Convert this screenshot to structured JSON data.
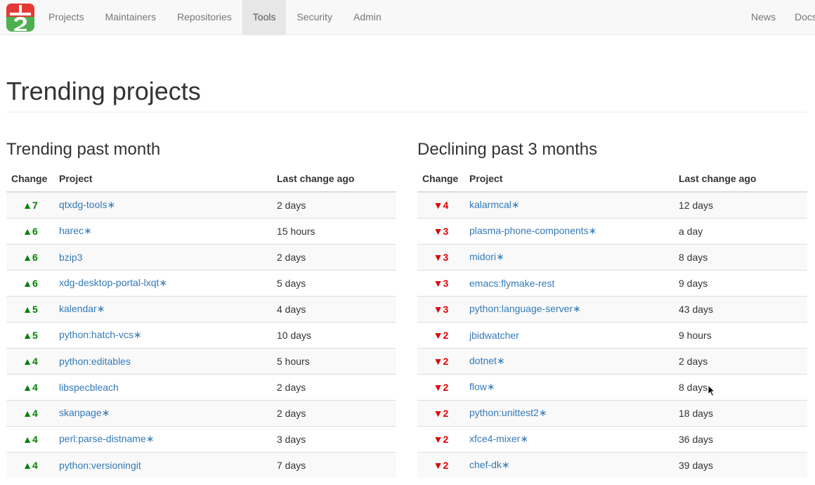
{
  "nav": {
    "left": [
      {
        "label": "Projects",
        "active": false
      },
      {
        "label": "Maintainers",
        "active": false
      },
      {
        "label": "Repositories",
        "active": false
      },
      {
        "label": "Tools",
        "active": true
      },
      {
        "label": "Security",
        "active": false
      },
      {
        "label": "Admin",
        "active": false
      }
    ],
    "right": [
      {
        "label": "News"
      },
      {
        "label": "Docs"
      }
    ]
  },
  "page_title": "Trending projects",
  "trending": {
    "title": "Trending past month",
    "columns": [
      "Change",
      "Project",
      "Last change ago"
    ],
    "rows": [
      {
        "change": "▲7",
        "project": "qtxdg-tools",
        "star": true,
        "ago": "2 days"
      },
      {
        "change": "▲6",
        "project": "harec",
        "star": true,
        "ago": "15 hours"
      },
      {
        "change": "▲6",
        "project": "bzip3",
        "star": false,
        "ago": "2 days"
      },
      {
        "change": "▲6",
        "project": "xdg-desktop-portal-lxqt",
        "star": true,
        "ago": "5 days"
      },
      {
        "change": "▲5",
        "project": "kalendar",
        "star": true,
        "ago": "4 days"
      },
      {
        "change": "▲5",
        "project": "python:hatch-vcs",
        "star": true,
        "ago": "10 days"
      },
      {
        "change": "▲4",
        "project": "python:editables",
        "star": false,
        "ago": "5 hours"
      },
      {
        "change": "▲4",
        "project": "libspecbleach",
        "star": false,
        "ago": "2 days"
      },
      {
        "change": "▲4",
        "project": "skanpage",
        "star": true,
        "ago": "2 days"
      },
      {
        "change": "▲4",
        "project": "perl:parse-distname",
        "star": true,
        "ago": "3 days"
      },
      {
        "change": "▲4",
        "project": "python:versioningit",
        "star": false,
        "ago": "7 days"
      }
    ]
  },
  "declining": {
    "title": "Declining past 3 months",
    "columns": [
      "Change",
      "Project",
      "Last change ago"
    ],
    "rows": [
      {
        "change": "▼4",
        "project": "kalarmcal",
        "star": true,
        "ago": "12 days"
      },
      {
        "change": "▼3",
        "project": "plasma-phone-components",
        "star": true,
        "ago": "a day"
      },
      {
        "change": "▼3",
        "project": "midori",
        "star": true,
        "ago": "8 days"
      },
      {
        "change": "▼3",
        "project": "emacs:flymake-rest",
        "star": false,
        "ago": "9 days"
      },
      {
        "change": "▼3",
        "project": "python:language-server",
        "star": true,
        "ago": "43 days"
      },
      {
        "change": "▼2",
        "project": "jbidwatcher",
        "star": false,
        "ago": "9 hours"
      },
      {
        "change": "▼2",
        "project": "dotnet",
        "star": true,
        "ago": "2 days"
      },
      {
        "change": "▼2",
        "project": "flow",
        "star": true,
        "ago": "8 days"
      },
      {
        "change": "▼2",
        "project": "python:unittest2",
        "star": true,
        "ago": "18 days"
      },
      {
        "change": "▼2",
        "project": "xfce4-mixer",
        "star": true,
        "ago": "36 days"
      },
      {
        "change": "▼2",
        "project": "chef-dk",
        "star": true,
        "ago": "39 days"
      }
    ]
  },
  "star_glyph": "∗",
  "colors": {
    "up": "#008000",
    "down": "#e00000",
    "link": "#337ab7"
  }
}
